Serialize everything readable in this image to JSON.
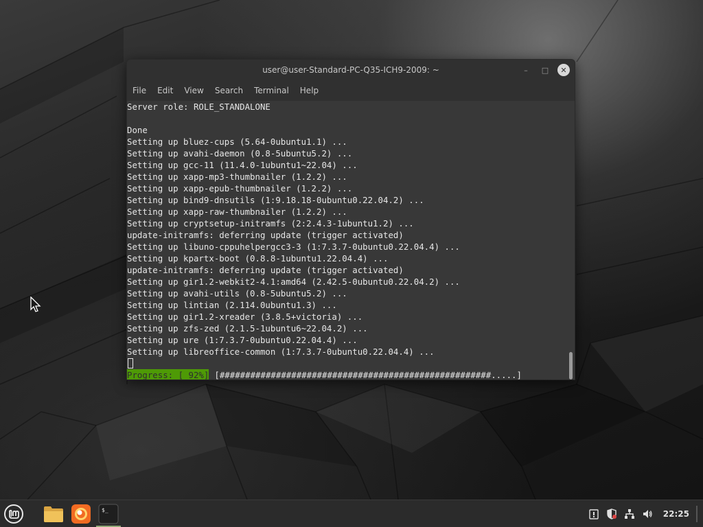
{
  "window": {
    "title": "user@user-Standard-PC-Q35-ICH9-2009: ~",
    "minimize_glyph": "–",
    "maximize_glyph": "□",
    "close_glyph": "✕"
  },
  "menu": [
    "File",
    "Edit",
    "View",
    "Search",
    "Terminal",
    "Help"
  ],
  "terminal": {
    "lines": [
      "Server role: ROLE_STANDALONE",
      "",
      "Done",
      "Setting up bluez-cups (5.64-0ubuntu1.1) ...",
      "Setting up avahi-daemon (0.8-5ubuntu5.2) ...",
      "Setting up gcc-11 (11.4.0-1ubuntu1~22.04) ...",
      "Setting up xapp-mp3-thumbnailer (1.2.2) ...",
      "Setting up xapp-epub-thumbnailer (1.2.2) ...",
      "Setting up bind9-dnsutils (1:9.18.18-0ubuntu0.22.04.2) ...",
      "Setting up xapp-raw-thumbnailer (1.2.2) ...",
      "Setting up cryptsetup-initramfs (2:2.4.3-1ubuntu1.2) ...",
      "update-initramfs: deferring update (trigger activated)",
      "Setting up libuno-cppuhelpergcc3-3 (1:7.3.7-0ubuntu0.22.04.4) ...",
      "Setting up kpartx-boot (0.8.8-1ubuntu1.22.04.4) ...",
      "update-initramfs: deferring update (trigger activated)",
      "Setting up gir1.2-webkit2-4.1:amd64 (2.42.5-0ubuntu0.22.04.2) ...",
      "Setting up avahi-utils (0.8-5ubuntu5.2) ...",
      "Setting up lintian (2.114.0ubuntu1.3) ...",
      "Setting up gir1.2-xreader (3.8.5+victoria) ...",
      "Setting up zfs-zed (2.1.5-1ubuntu6~22.04.2) ...",
      "Setting up ure (1:7.3.7-0ubuntu0.22.04.4) ...",
      "Setting up libreoffice-common (1:7.3.7-0ubuntu0.22.04.4) ..."
    ],
    "progress_label": "Progress: [ 92%]",
    "progress_bar": "[#####################################################.....]",
    "progress_percent": 92,
    "colors": {
      "background": "#383838",
      "foreground": "#e6e6e6",
      "progress_highlight": "#4e9a06"
    }
  },
  "taskbar": {
    "apps": [
      {
        "name": "Menu",
        "icon": "linux-mint-logo-icon"
      },
      {
        "name": "Files",
        "icon": "folder-icon"
      },
      {
        "name": "Firefox",
        "icon": "firefox-icon"
      },
      {
        "name": "Terminal",
        "icon": "terminal-icon",
        "active": true
      }
    ],
    "tray_icons": [
      "notes-icon",
      "shield-update-icon",
      "network-icon",
      "volume-icon"
    ],
    "clock": "22:25"
  }
}
